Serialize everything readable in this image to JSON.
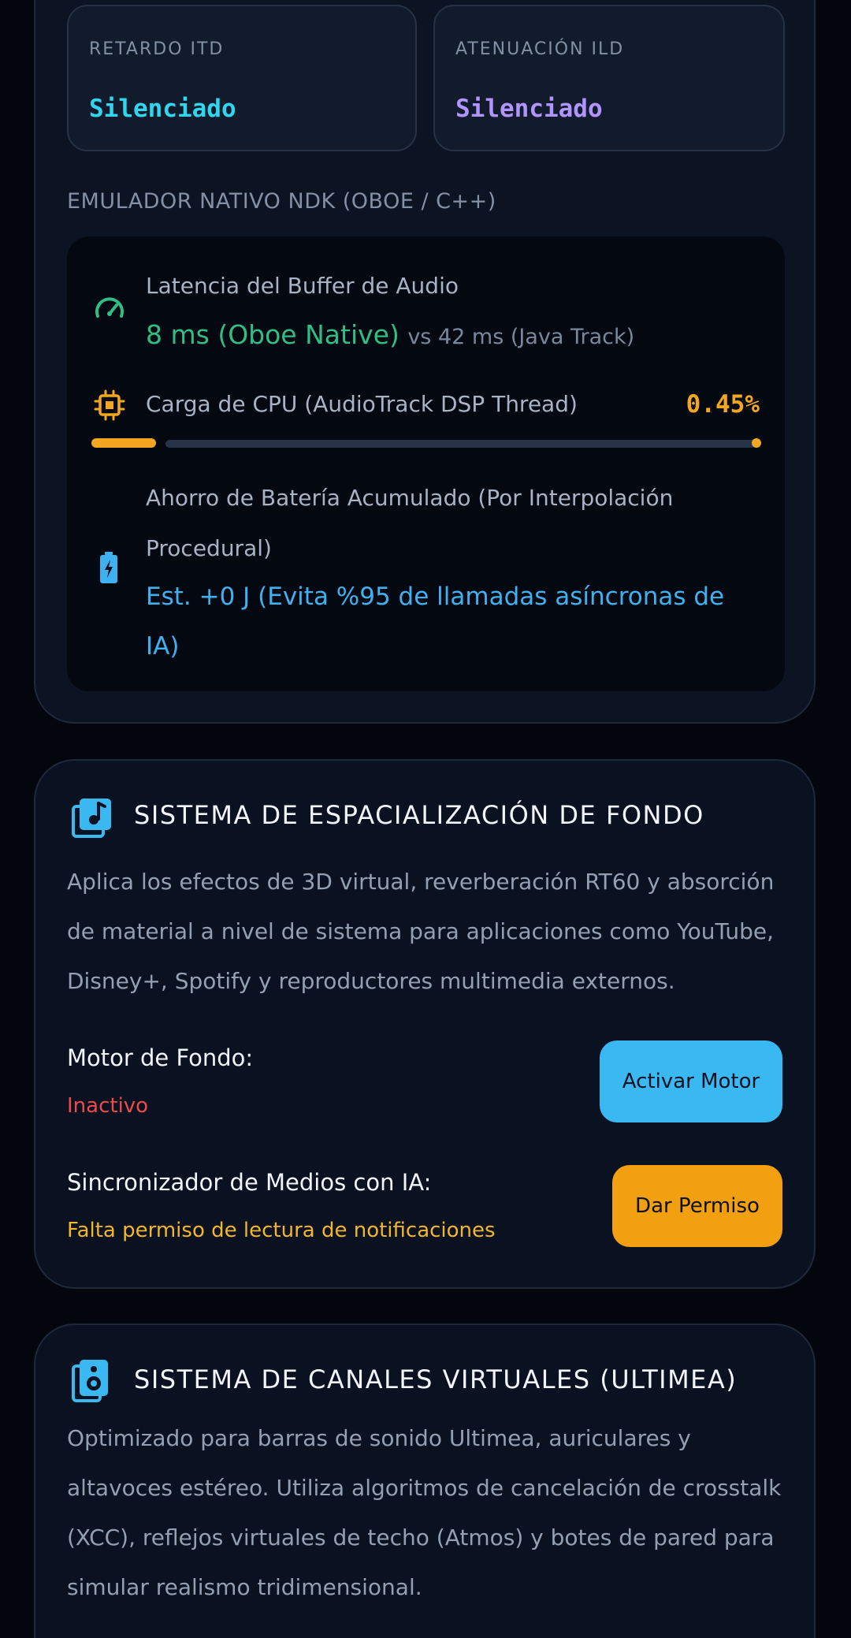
{
  "itd": {
    "label": "RETARDO ITD",
    "value": "Silenciado"
  },
  "ild": {
    "label": "ATENUACIÓN ILD",
    "value": "Silenciado"
  },
  "ndk": {
    "caption": "EMULADOR NATIVO NDK (OBOE / C++)",
    "latency_title": "Latencia del Buffer de Audio",
    "latency_value": "8 ms (Oboe Native)",
    "latency_vs": "vs 42 ms (Java Track)",
    "cpu_title": "Carga de CPU (AudioTrack DSP Thread)",
    "cpu_value": "0.45%",
    "cpu_fraction": 0.0045,
    "battery_title": "Ahorro de Batería Acumulado (Por Interpolación Procedural)",
    "battery_value": "Est. +0 J (Evita %95 de llamadas asíncronas de IA)",
    "accent_green": "#2fbf86",
    "accent_amber": "#f3a721",
    "accent_blue": "#40b1f0"
  },
  "background_system": {
    "title": "SISTEMA DE ESPACIALIZACIÓN DE FONDO",
    "description": "Aplica los efectos de 3D virtual, reverberación RT60 y absorción de material a nivel de sistema para aplicaciones como YouTube, Disney+, Spotify y reproductores multimedia externos.",
    "engine_label": "Motor de Fondo:",
    "engine_status": "Inactivo",
    "engine_button": "Activar Motor",
    "sync_label": "Sincronizador de Medios con IA:",
    "sync_status": "Falta permiso de lectura de notificaciones",
    "sync_button": "Dar Permiso",
    "icon": "music-library-icon"
  },
  "virtual_channels": {
    "title": "SISTEMA DE CANALES VIRTUALES (ULTIMEA)",
    "description": "Optimizado para barras de sonido Ultimea, auriculares y altavoces estéreo. Utiliza algoritmos de cancelación de crosstalk (XCC), reflejos virtuales de techo (Atmos) y botes de pared para simular realismo tridimensional.",
    "icon": "speaker-icon"
  }
}
